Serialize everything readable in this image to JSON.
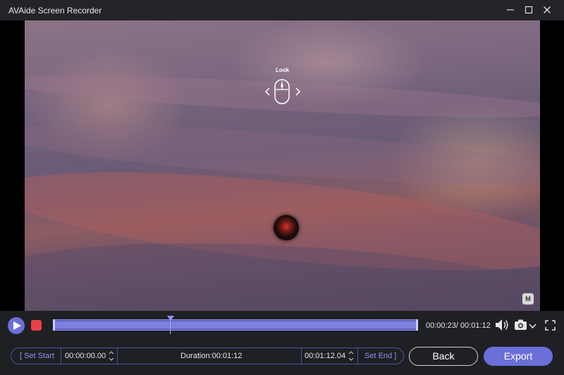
{
  "window": {
    "title": "AVAide Screen Recorder"
  },
  "video": {
    "overlay_label": "Look",
    "watermark": "M"
  },
  "playback": {
    "current_time": "00:00:23",
    "total_time": "00:01:12",
    "time_display": "00:00:23/ 00:01:12",
    "progress_fraction": 0.32
  },
  "trim": {
    "set_start_label": "[ Set Start",
    "start_time": "00:00:00.00",
    "duration_text": "Duration:00:01:12",
    "end_time": "00:01:12.04",
    "set_end_label": "Set End ]"
  },
  "actions": {
    "back_label": "Back",
    "export_label": "Export"
  },
  "colors": {
    "accent": "#6b6fd8",
    "stop": "#e8414a",
    "background": "#1f2023"
  }
}
